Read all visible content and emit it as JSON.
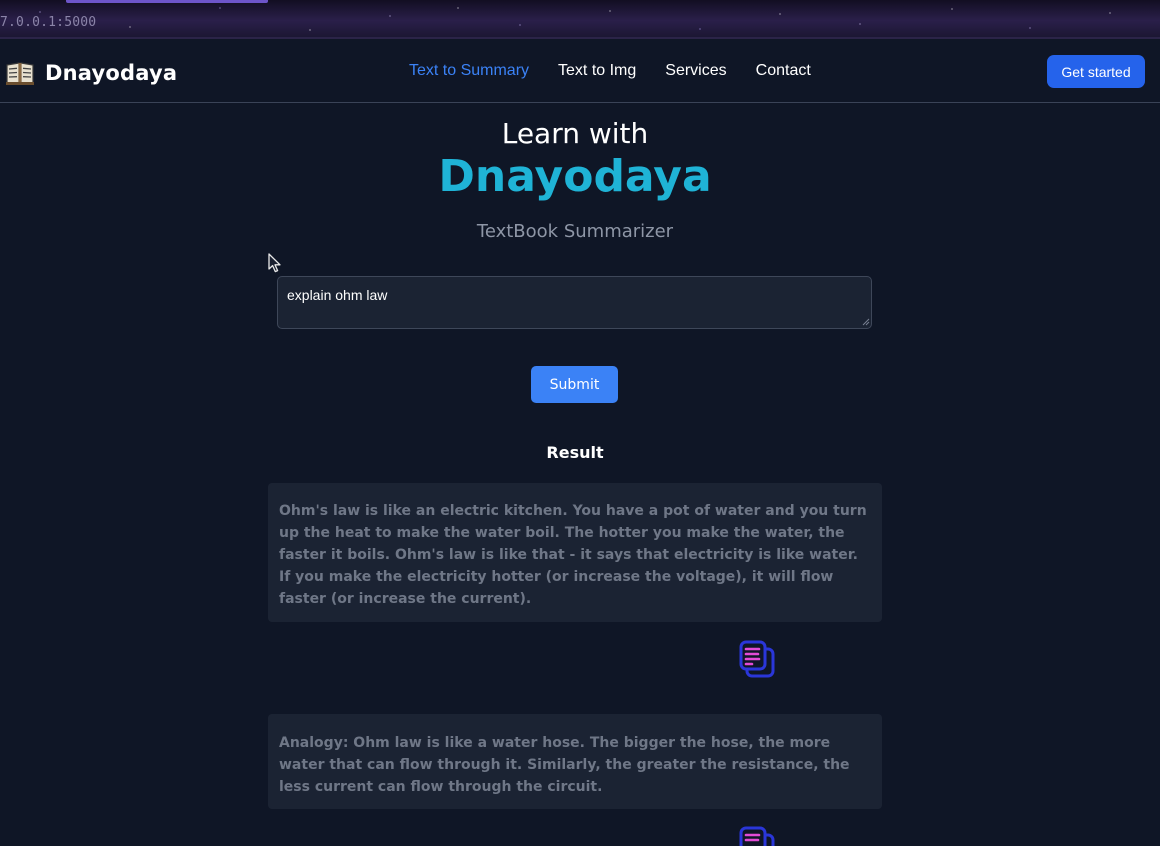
{
  "browser": {
    "url": "7.0.0.1:5000"
  },
  "navbar": {
    "brand": "Dnayodaya",
    "links": [
      "Text to Summary",
      "Text to Img",
      "Services",
      "Contact"
    ],
    "cta": "Get started"
  },
  "hero": {
    "line1": "Learn with",
    "line2": "Dnayodaya",
    "subtitle": "TextBook Summarizer"
  },
  "query": {
    "value": "explain ohm law"
  },
  "submit_label": "Submit",
  "result": {
    "heading": "Result",
    "items": [
      "Ohm's law is like an electric kitchen. You have a pot of water and you turn up the heat to make the water boil. The hotter you make the water, the faster it boils. Ohm's law is like that - it says that electricity is like water. If you make the electricity hotter (or increase the voltage), it will flow faster (or increase the current).",
      "Analogy: Ohm law is like a water hose. The bigger the hose, the more water that can flow through it. Similarly, the greater the resistance, the less current can flow through the circuit."
    ]
  },
  "colors": {
    "background": "#0f1626",
    "accent_blue": "#3b82f6",
    "brand_cyan": "#1fb3d6",
    "card": "#1b2333"
  },
  "icons": {
    "brand": "book-icon",
    "copy": "copy-icon"
  }
}
